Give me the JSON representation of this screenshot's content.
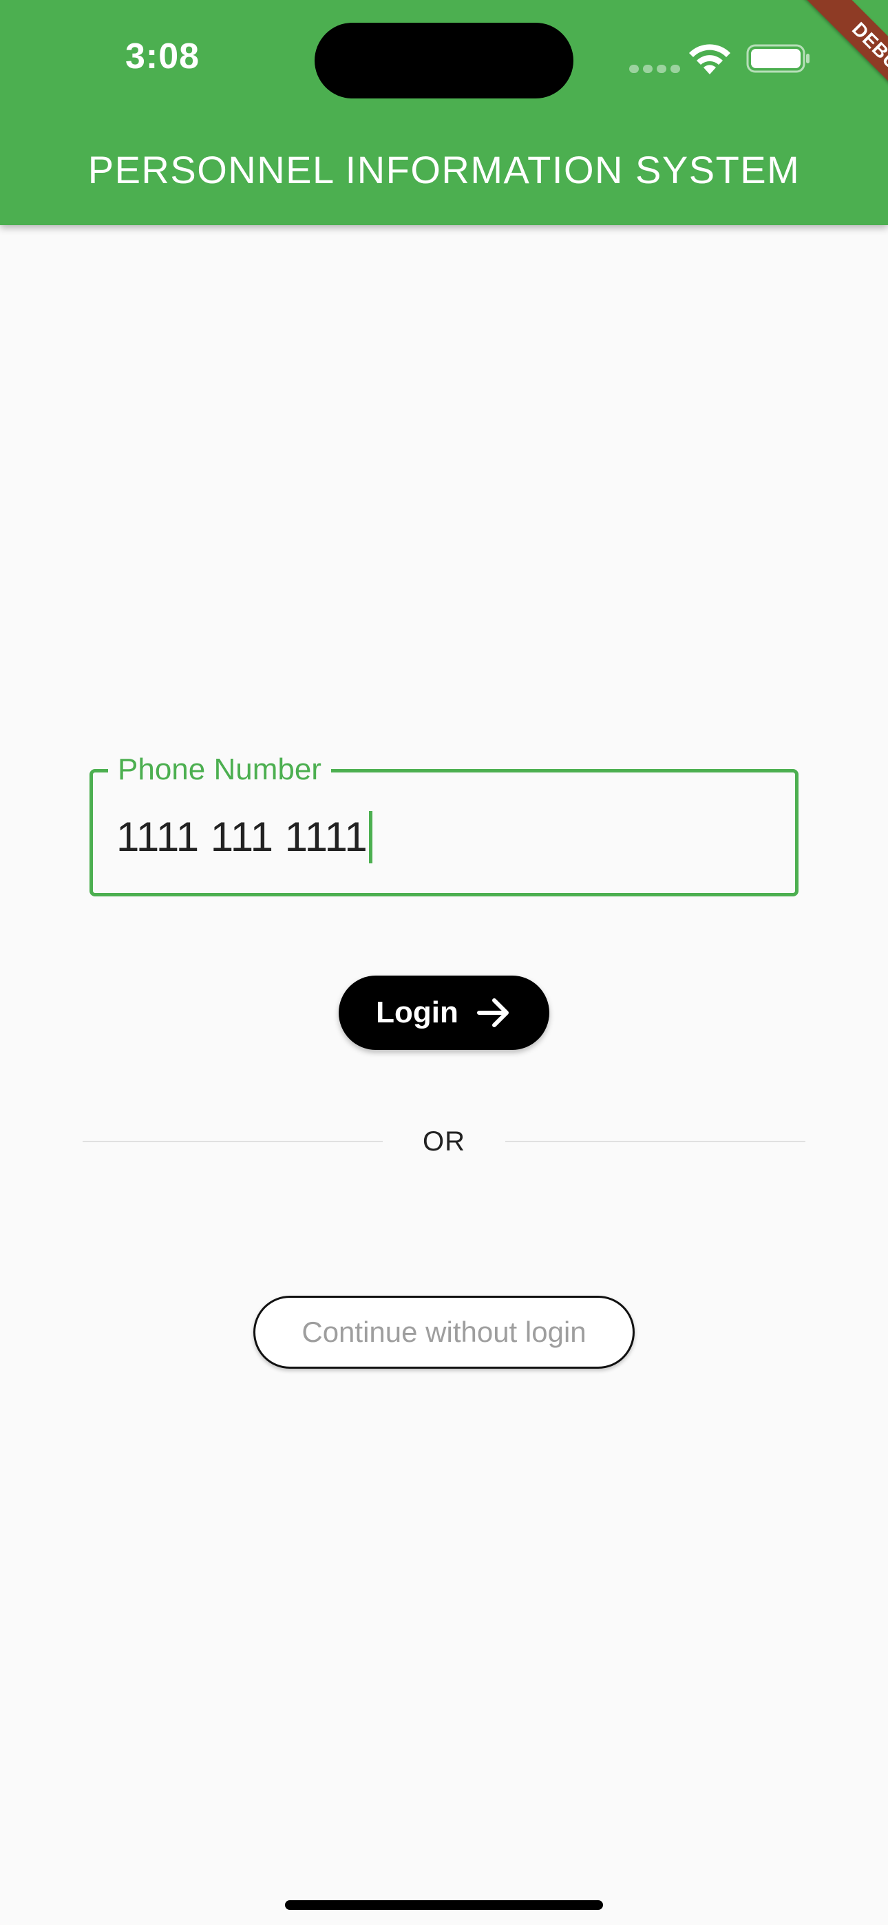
{
  "status_bar": {
    "time": "3:08"
  },
  "appbar": {
    "title": "PERSONNEL INFORMATION SYSTEM",
    "color": "#4caf50"
  },
  "debug_banner": {
    "label": "DEBUG"
  },
  "login_form": {
    "phone_label": "Phone Number",
    "phone_value": "1111 111 1111",
    "login_label": "Login",
    "or_text": "OR",
    "continue_label": "Continue without login"
  },
  "icons": {
    "wifi": "wifi-icon",
    "battery": "battery-icon",
    "arrow": "arrow-right-icon"
  }
}
